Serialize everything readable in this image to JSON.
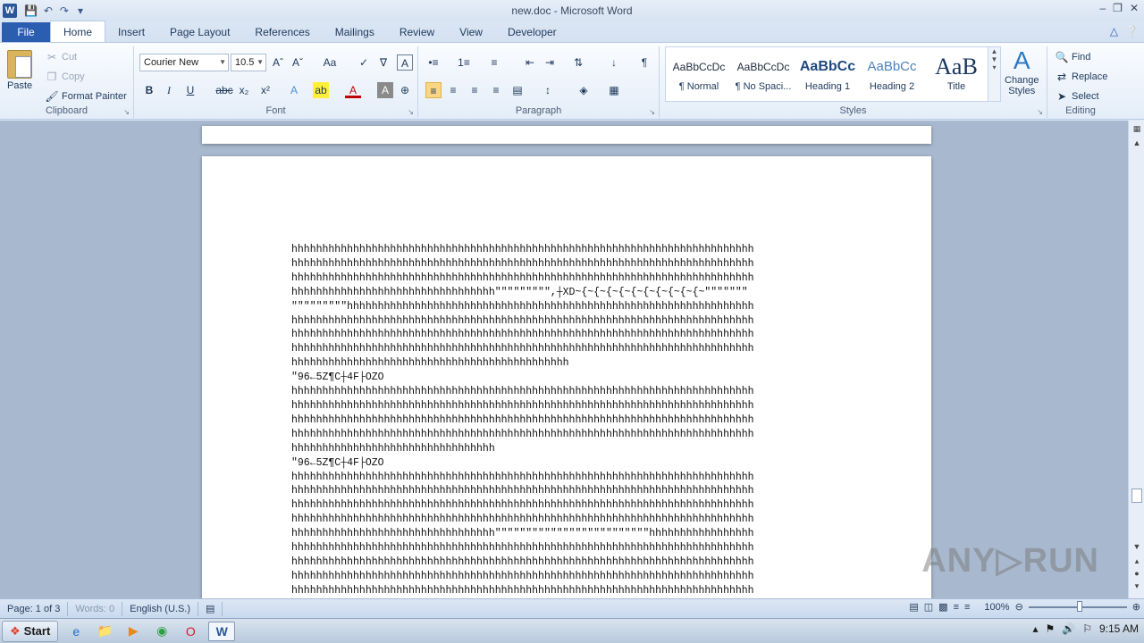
{
  "window": {
    "title": "new.doc - Microsoft Word",
    "app_icon_letter": "W",
    "controls": [
      "–",
      "❐",
      "✕"
    ]
  },
  "quick_access": [
    "💾",
    "↶",
    "↷",
    "▾"
  ],
  "tabs": [
    "File",
    "Home",
    "Insert",
    "Page Layout",
    "References",
    "Mailings",
    "Review",
    "View",
    "Developer"
  ],
  "ribbon": {
    "clipboard": {
      "label": "Clipboard",
      "paste": "Paste",
      "cut": "Cut",
      "copy": "Copy",
      "format_painter": "Format Painter"
    },
    "font": {
      "label": "Font",
      "font_name": "Courier New",
      "font_size": "10.5",
      "bold": "B",
      "italic": "I",
      "underline": "U",
      "strike": "abc",
      "subscript": "x₂",
      "superscript": "x²",
      "grow": "Aˆ",
      "shrink": "Aˇ",
      "change_case": "Aa",
      "clear": "A"
    },
    "paragraph": {
      "label": "Paragraph",
      "pilcrow": "¶"
    },
    "styles": {
      "label": "Styles",
      "items": [
        {
          "sample": "AaBbCcDc",
          "name": "¶ Normal"
        },
        {
          "sample": "AaBbCcDc",
          "name": "¶ No Spaci..."
        },
        {
          "sample": "AaBbCc",
          "name": "Heading 1"
        },
        {
          "sample": "AaBbCc",
          "name": "Heading 2"
        },
        {
          "sample": "AaB",
          "name": "Title"
        }
      ],
      "change_styles_1": "Change",
      "change_styles_2": "Styles"
    },
    "editing": {
      "label": "Editing",
      "find": "Find",
      "replace": "Replace",
      "select": "Select"
    }
  },
  "document": {
    "lines": [
      "hhhhhhhhhhhhhhhhhhhhhhhhhhhhhhhhhhhhhhhhhhhhhhhhhhhhhhhhhhhhhhhhhhhhhhhhhhh",
      "hhhhhhhhhhhhhhhhhhhhhhhhhhhhhhhhhhhhhhhhhhhhhhhhhhhhhhhhhhhhhhhhhhhhhhhhhhh",
      "hhhhhhhhhhhhhhhhhhhhhhhhhhhhhhhhhhhhhhhhhhhhhhhhhhhhhhhhhhhhhhhhhhhhhhhhhhh",
      "hhhhhhhhhhhhhhhhhhhhhhhhhhhhhhhhh\"\"\"\"\"\"\"\"\",┼XD~{~{~{~{~{~{~{~{~{~{~\"\"\"\"\"\"\"",
      "\"\"\"\"\"\"\"\"\"hhhhhhhhhhhhhhhhhhhhhhhhhhhhhhhhhhhhhhhhhhhhhhhhhhhhhhhhhhhhhhhhhh",
      "hhhhhhhhhhhhhhhhhhhhhhhhhhhhhhhhhhhhhhhhhhhhhhhhhhhhhhhhhhhhhhhhhhhhhhhhhhh",
      "hhhhhhhhhhhhhhhhhhhhhhhhhhhhhhhhhhhhhhhhhhhhhhhhhhhhhhhhhhhhhhhhhhhhhhhhhhh",
      "hhhhhhhhhhhhhhhhhhhhhhhhhhhhhhhhhhhhhhhhhhhhhhhhhhhhhhhhhhhhhhhhhhhhhhhhhhh",
      "hhhhhhhhhhhhhhhhhhhhhhhhhhhhhhhhhhhhhhhhhhhhh",
      "\"96←5Z¶C┼4F├OZO",
      "hhhhhhhhhhhhhhhhhhhhhhhhhhhhhhhhhhhhhhhhhhhhhhhhhhhhhhhhhhhhhhhhhhhhhhhhhhh",
      "hhhhhhhhhhhhhhhhhhhhhhhhhhhhhhhhhhhhhhhhhhhhhhhhhhhhhhhhhhhhhhhhhhhhhhhhhhh",
      "hhhhhhhhhhhhhhhhhhhhhhhhhhhhhhhhhhhhhhhhhhhhhhhhhhhhhhhhhhhhhhhhhhhhhhhhhhh",
      "hhhhhhhhhhhhhhhhhhhhhhhhhhhhhhhhhhhhhhhhhhhhhhhhhhhhhhhhhhhhhhhhhhhhhhhhhhh",
      "hhhhhhhhhhhhhhhhhhhhhhhhhhhhhhhhh",
      "\"96←5Z¶C┼4F├OZO",
      "hhhhhhhhhhhhhhhhhhhhhhhhhhhhhhhhhhhhhhhhhhhhhhhhhhhhhhhhhhhhhhhhhhhhhhhhhhh",
      "hhhhhhhhhhhhhhhhhhhhhhhhhhhhhhhhhhhhhhhhhhhhhhhhhhhhhhhhhhhhhhhhhhhhhhhhhhh",
      "hhhhhhhhhhhhhhhhhhhhhhhhhhhhhhhhhhhhhhhhhhhhhhhhhhhhhhhhhhhhhhhhhhhhhhhhhhh",
      "hhhhhhhhhhhhhhhhhhhhhhhhhhhhhhhhhhhhhhhhhhhhhhhhhhhhhhhhhhhhhhhhhhhhhhhhhhh",
      "hhhhhhhhhhhhhhhhhhhhhhhhhhhhhhhhh\"\"\"\"\"\"\"\"\"\"\"\"\"\"\"\"\"\"\"\"\"\"\"\"\"hhhhhhhhhhhhhhhhh",
      "hhhhhhhhhhhhhhhhhhhhhhhhhhhhhhhhhhhhhhhhhhhhhhhhhhhhhhhhhhhhhhhhhhhhhhhhhhh",
      "hhhhhhhhhhhhhhhhhhhhhhhhhhhhhhhhhhhhhhhhhhhhhhhhhhhhhhhhhhhhhhhhhhhhhhhhhhh",
      "hhhhhhhhhhhhhhhhhhhhhhhhhhhhhhhhhhhhhhhhhhhhhhhhhhhhhhhhhhhhhhhhhhhhhhhhhhh",
      "hhhhhhhhhhhhhhhhhhhhhhhhhhhhhhhhhhhhhhhhhhhhhhhhhhhhhhhhhhhhhhhhhhhhhhhhhhh"
    ]
  },
  "statusbar": {
    "page": "Page: 1 of 3",
    "words": "Words: 0",
    "language": "English (U.S.)",
    "zoom": "100%"
  },
  "taskbar": {
    "start": "Start",
    "time": "9:15 AM"
  },
  "watermark": "ANY▷RUN",
  "colors": {
    "accent": "#2b5eb0",
    "ribbon_bg": "#e4edf8",
    "doc_bg": "#a8b9cf"
  }
}
